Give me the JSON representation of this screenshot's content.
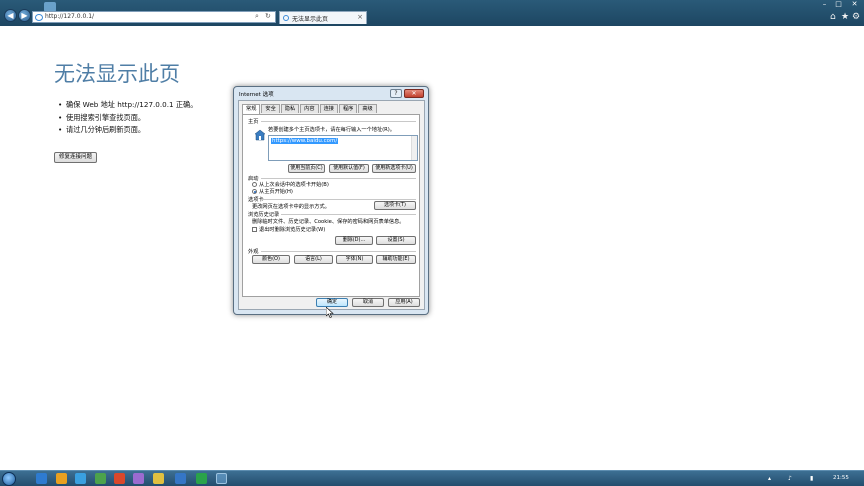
{
  "browser": {
    "address": "http://127.0.0.1/",
    "tab_title": "无法显示此页",
    "tab_close": "×",
    "refresh_icon": "↻",
    "search_icon": "⌕",
    "back_icon": "◀",
    "forward_icon": "▶",
    "controls": {
      "minimize": "–",
      "maximize": "□",
      "close": "✕"
    },
    "toolbar": {
      "home": "⌂",
      "favorites": "★",
      "tools": "⚙"
    }
  },
  "page": {
    "title": "无法显示此页",
    "bullets": [
      "确保 Web 地址 http://127.0.0.1 正确。",
      "使用搜索引擎查找页面。",
      "请过几分钟后刷新页面。"
    ],
    "fix_button": "修复连接问题"
  },
  "dialog": {
    "title": "Internet 选项",
    "help": "?",
    "close": "✕",
    "tabs": [
      "常规",
      "安全",
      "隐私",
      "内容",
      "连接",
      "程序",
      "高级"
    ],
    "active_tab": "常规",
    "home": {
      "section": "主页",
      "instruction": "若要创建多个主页选项卡，请在每行输入一个地址(R)。",
      "value": "https://www.baidu.com/",
      "buttons": [
        "使用当前页(C)",
        "使用默认值(F)",
        "使用新选项卡(U)"
      ]
    },
    "startup": {
      "section": "启动",
      "options": [
        "从上次会话中的选项卡开始(B)",
        "从主页开始(H)"
      ],
      "selected": 1
    },
    "tabs_section": {
      "section": "选项卡",
      "desc": "更改网页在选项卡中的显示方式。",
      "button": "选项卡(T)"
    },
    "history": {
      "section": "浏览历史记录",
      "desc": "删除临时文件、历史记录、Cookie、保存的密码和网页表单信息。",
      "checkbox": "退出时删除浏览历史记录(W)",
      "delete_button": "删除(D)...",
      "settings_button": "设置(S)"
    },
    "appearance": {
      "section": "外观",
      "buttons": [
        "颜色(O)",
        "语言(L)",
        "字体(N)",
        "辅助功能(E)"
      ]
    },
    "footer": {
      "ok": "确定",
      "cancel": "取消",
      "apply": "应用(A)"
    }
  },
  "taskbar": {
    "clock": "21:55",
    "tray_icons": [
      "▴",
      "♪",
      "▮"
    ]
  }
}
